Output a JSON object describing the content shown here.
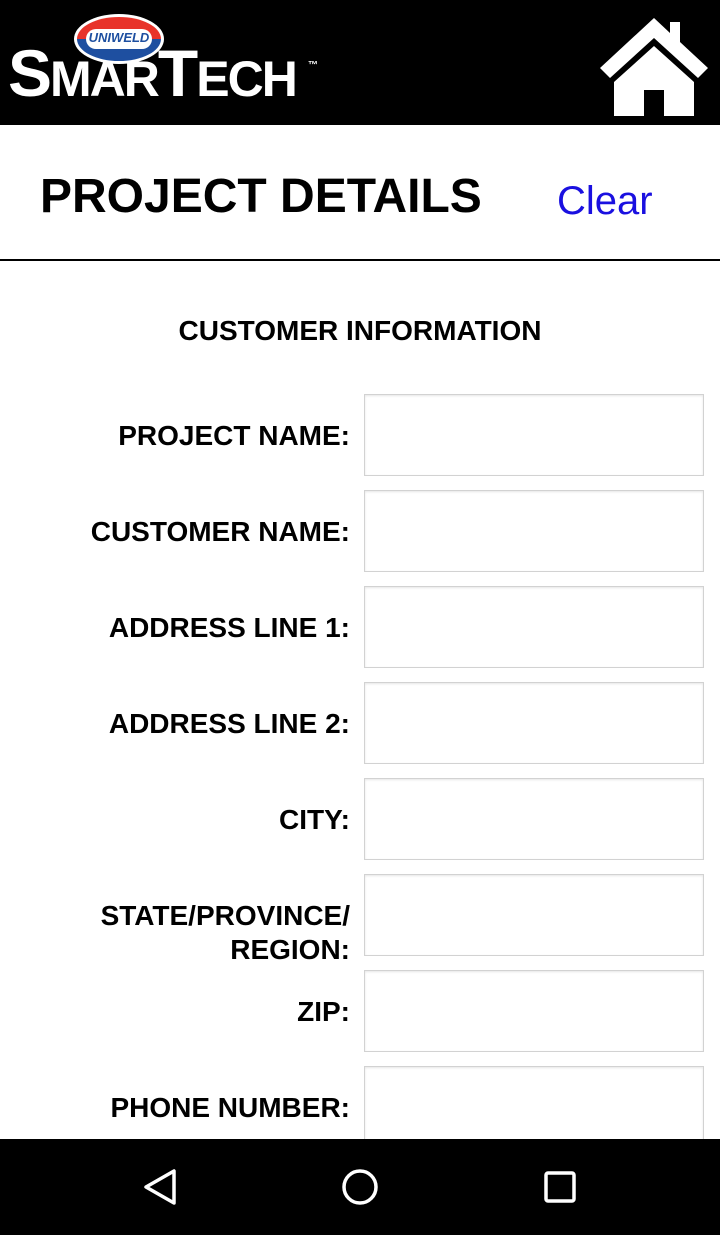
{
  "app": {
    "logo_badge": "UNIWELD",
    "logo_word_1": "S",
    "logo_word_2": "MAR",
    "logo_word_3": "T",
    "logo_word_4": "ECH",
    "logo_tm": "™",
    "home_icon": "home-icon"
  },
  "header": {
    "title": "PROJECT DETAILS",
    "clear_label": "Clear",
    "clear_color": "#1a10e0"
  },
  "form": {
    "section_title": "CUSTOMER INFORMATION",
    "fields": [
      {
        "label": "PROJECT NAME:",
        "value": ""
      },
      {
        "label": "CUSTOMER NAME:",
        "value": ""
      },
      {
        "label": "ADDRESS LINE 1:",
        "value": ""
      },
      {
        "label": "ADDRESS LINE 2:",
        "value": ""
      },
      {
        "label": "CITY:",
        "value": ""
      },
      {
        "label_line1": "STATE/PROVINCE/",
        "label_line2": "REGION:",
        "value": ""
      },
      {
        "label": "ZIP:",
        "value": ""
      },
      {
        "label": "PHONE NUMBER:",
        "value": ""
      }
    ]
  },
  "navbar": {
    "icons": [
      "back-icon",
      "home-circle-icon",
      "recents-icon"
    ]
  }
}
